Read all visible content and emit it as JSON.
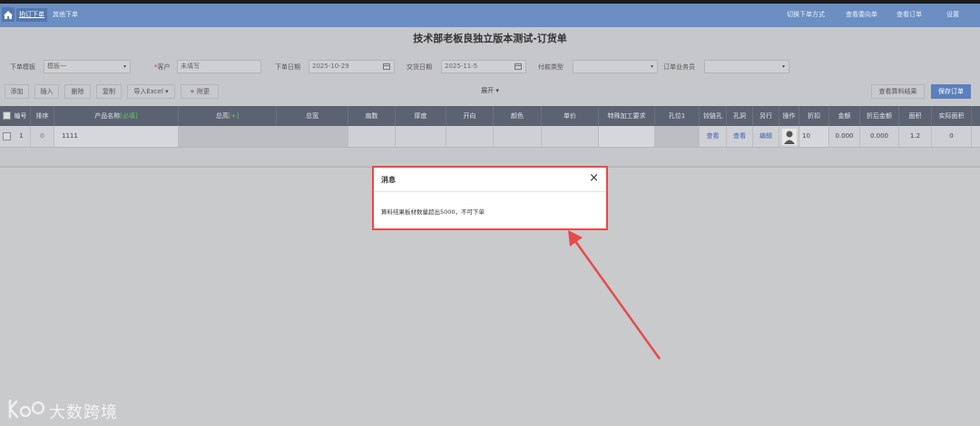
{
  "nav": {
    "tabs": [
      "拍订下单",
      "其他下单"
    ],
    "right": [
      "切换下单方式",
      "查看委向单",
      "查看订单",
      "设置"
    ]
  },
  "page": {
    "title": "技术部老板良独立版本测试-订货单"
  },
  "form": {
    "template_label": "下单模板",
    "template_value": "模板一",
    "customer_label": "客户",
    "customer_value": "未填写",
    "order_date_label": "下单日期",
    "order_date_value": "2025-10-29",
    "delivery_date_label": "交货日期",
    "delivery_date_value": "2025-11-5",
    "payment_label": "付款类型",
    "payment_value": "",
    "salesman_label": "订单业务员",
    "salesman_value": ""
  },
  "toolbar": {
    "add": "添加",
    "insert": "插入",
    "delete": "删除",
    "copy": "复制",
    "import": "导入Excel ▾",
    "attach": "+ 附更",
    "expand": "展开 ▾",
    "view_results": "查看算料结果",
    "save": "保存订单"
  },
  "table": {
    "headers": {
      "no": "编号",
      "sort": "排序",
      "product": "产品名称",
      "product_tag": "[必填]",
      "total": "总高",
      "total_tag": "[+]",
      "height": "总宽",
      "qty": "扇数",
      "thickness": "厚度",
      "opening": "开向",
      "color": "颜色",
      "price": "单价",
      "special": "特殊加工要求",
      "hole": "孔位1",
      "edge_hole": "铰链孔",
      "handle_hole": "孔洞",
      "window": "另行",
      "op": "操作",
      "discount": "折扣",
      "amount": "金额",
      "discount_amount": "折后金额",
      "area": "面积",
      "actual_area": "实际面积"
    },
    "row": {
      "no": "1",
      "product": "1111",
      "edge_hole": "查看",
      "handle_hole": "查看",
      "window": "编辑",
      "discount": "10",
      "amount": "0.000",
      "discount_amount": "0.000",
      "area": "1.2",
      "actual_area": "0"
    }
  },
  "modal": {
    "title": "消息",
    "close": "×",
    "message": "算料结果板材数量超出5000，不可下单"
  },
  "watermark": {
    "text": "大数跨境"
  }
}
